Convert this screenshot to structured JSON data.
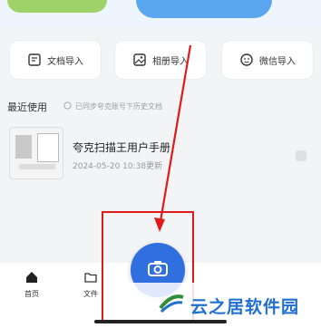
{
  "import_buttons": [
    {
      "label": "文档导入",
      "icon": "document-import-icon"
    },
    {
      "label": "相册导入",
      "icon": "album-import-icon"
    },
    {
      "label": "微信导入",
      "icon": "wechat-import-icon"
    }
  ],
  "recent": {
    "title": "最近使用",
    "hint": "已同步夸克账号下历史文档"
  },
  "document": {
    "title": "夸克扫描王用户手册",
    "date": "2024-05-20 10:38更新"
  },
  "bottom_tabs": [
    {
      "label": "首页",
      "icon": "home-icon"
    },
    {
      "label": "文件",
      "icon": "folder-icon"
    }
  ],
  "fab": {
    "icon": "camera-icon"
  },
  "watermark": {
    "text": "云之居软件园"
  },
  "colors": {
    "accent": "#2f6fe0",
    "highlight": "#e01a1a",
    "watermark": "#1f6fd1"
  }
}
